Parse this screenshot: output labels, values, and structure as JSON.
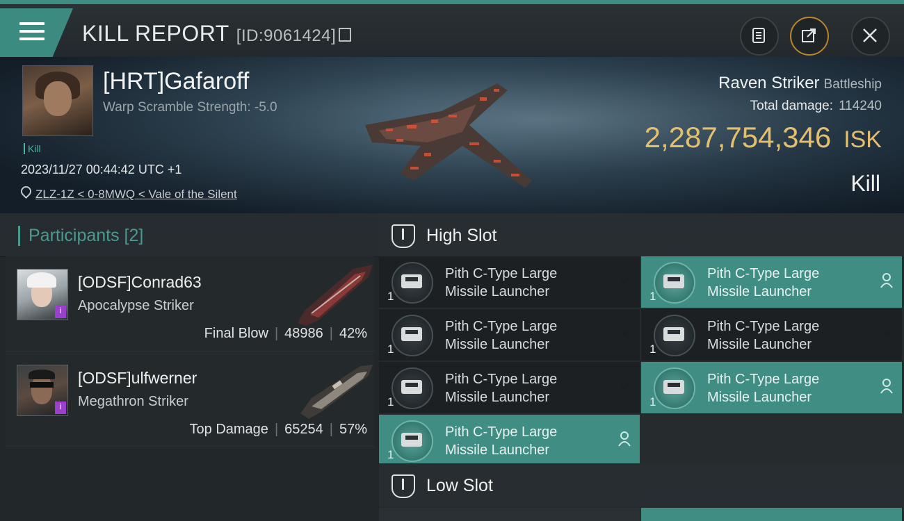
{
  "header": {
    "title": "KILL REPORT",
    "report_id": "[ID:9061424]",
    "colors": {
      "accent": "#3f8d83",
      "isk": "#e4bf6e"
    }
  },
  "victim": {
    "name": "[HRT]Gafaroff",
    "warp": "Warp Scramble Strength: -5.0",
    "tag": "Kill",
    "datetime": "2023/11/27 00:44:42 UTC +1",
    "location": "ZLZ-1Z < 0-8MWQ < Vale of the Silent",
    "ship_name": "Raven Striker",
    "ship_class": "Battleship",
    "total_damage_label": "Total damage:",
    "total_damage": "114240",
    "isk_value": "2,287,754,346",
    "isk_unit": "ISK",
    "result": "Kill"
  },
  "participants": {
    "title": "Participants [2]",
    "rows": [
      {
        "name": "[ODSF]Conrad63",
        "ship": "Apocalypse Striker",
        "role": "Final Blow",
        "damage": "48986",
        "pct": "42%"
      },
      {
        "name": "[ODSF]ulfwerner",
        "ship": "Megathron Striker",
        "role": "Top Damage",
        "damage": "65254",
        "pct": "57%"
      }
    ]
  },
  "slots": {
    "high_label": "High Slot",
    "low_label": "Low Slot",
    "high": [
      {
        "qty": "1",
        "line1": "Pith C-Type Large",
        "line2": "Missile Launcher",
        "state": "destroyed"
      },
      {
        "qty": "1",
        "line1": "Pith C-Type Large",
        "line2": "Missile Launcher",
        "state": "dropped"
      },
      {
        "qty": "1",
        "line1": "Pith C-Type Large",
        "line2": "Missile Launcher",
        "state": "destroyed"
      },
      {
        "qty": "1",
        "line1": "Pith C-Type Large",
        "line2": "Missile Launcher",
        "state": "destroyed"
      },
      {
        "qty": "1",
        "line1": "Pith C-Type Large",
        "line2": "Missile Launcher",
        "state": "destroyed"
      },
      {
        "qty": "1",
        "line1": "Pith C-Type Large",
        "line2": "Missile Launcher",
        "state": "dropped"
      },
      {
        "qty": "1",
        "line1": "Pith C-Type Large",
        "line2": "Missile Launcher",
        "state": "dropped"
      }
    ]
  }
}
